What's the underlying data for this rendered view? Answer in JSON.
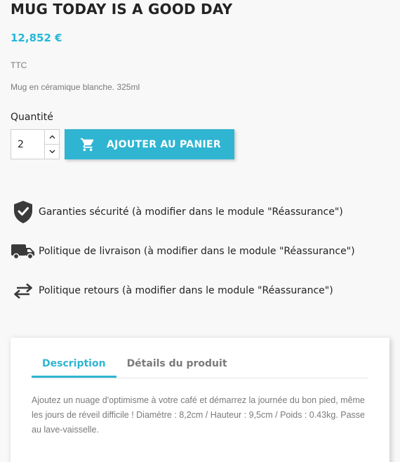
{
  "product": {
    "title": "MUG TODAY IS A GOOD DAY",
    "price": "12,852 €",
    "tax_label": "TTC",
    "short_description": "Mug en céramique blanche. 325ml"
  },
  "purchase": {
    "quantity_label": "Quantité",
    "quantity_value": "2",
    "add_to_cart_label": "AJOUTER AU PANIER"
  },
  "reassurance": {
    "items": [
      {
        "icon": "shield-check-icon",
        "text": "Garanties sécurité (à modifier dans le module \"Réassurance\")"
      },
      {
        "icon": "truck-icon",
        "text": "Politique de livraison (à modifier dans le module \"Réassurance\")"
      },
      {
        "icon": "swap-arrows-icon",
        "text": "Politique retours (à modifier dans le module \"Réassurance\")"
      }
    ]
  },
  "tabs": {
    "items": [
      {
        "label": "Description",
        "active": true
      },
      {
        "label": "Détails du produit",
        "active": false
      }
    ],
    "description_text": "Ajoutez un nuage d'optimisme à votre café et démarrez la journée du bon pied, même les jours de réveil difficile ! Diamètre : 8,2cm / Hauteur : 9,5cm / Poids : 0.43kg. Passe au lave-vaisselle."
  },
  "colors": {
    "accent": "#2fb5d2",
    "price": "#24b9d7",
    "text_dark": "#232323",
    "text_muted": "#7a7a7a",
    "background": "#f8f8f8"
  }
}
